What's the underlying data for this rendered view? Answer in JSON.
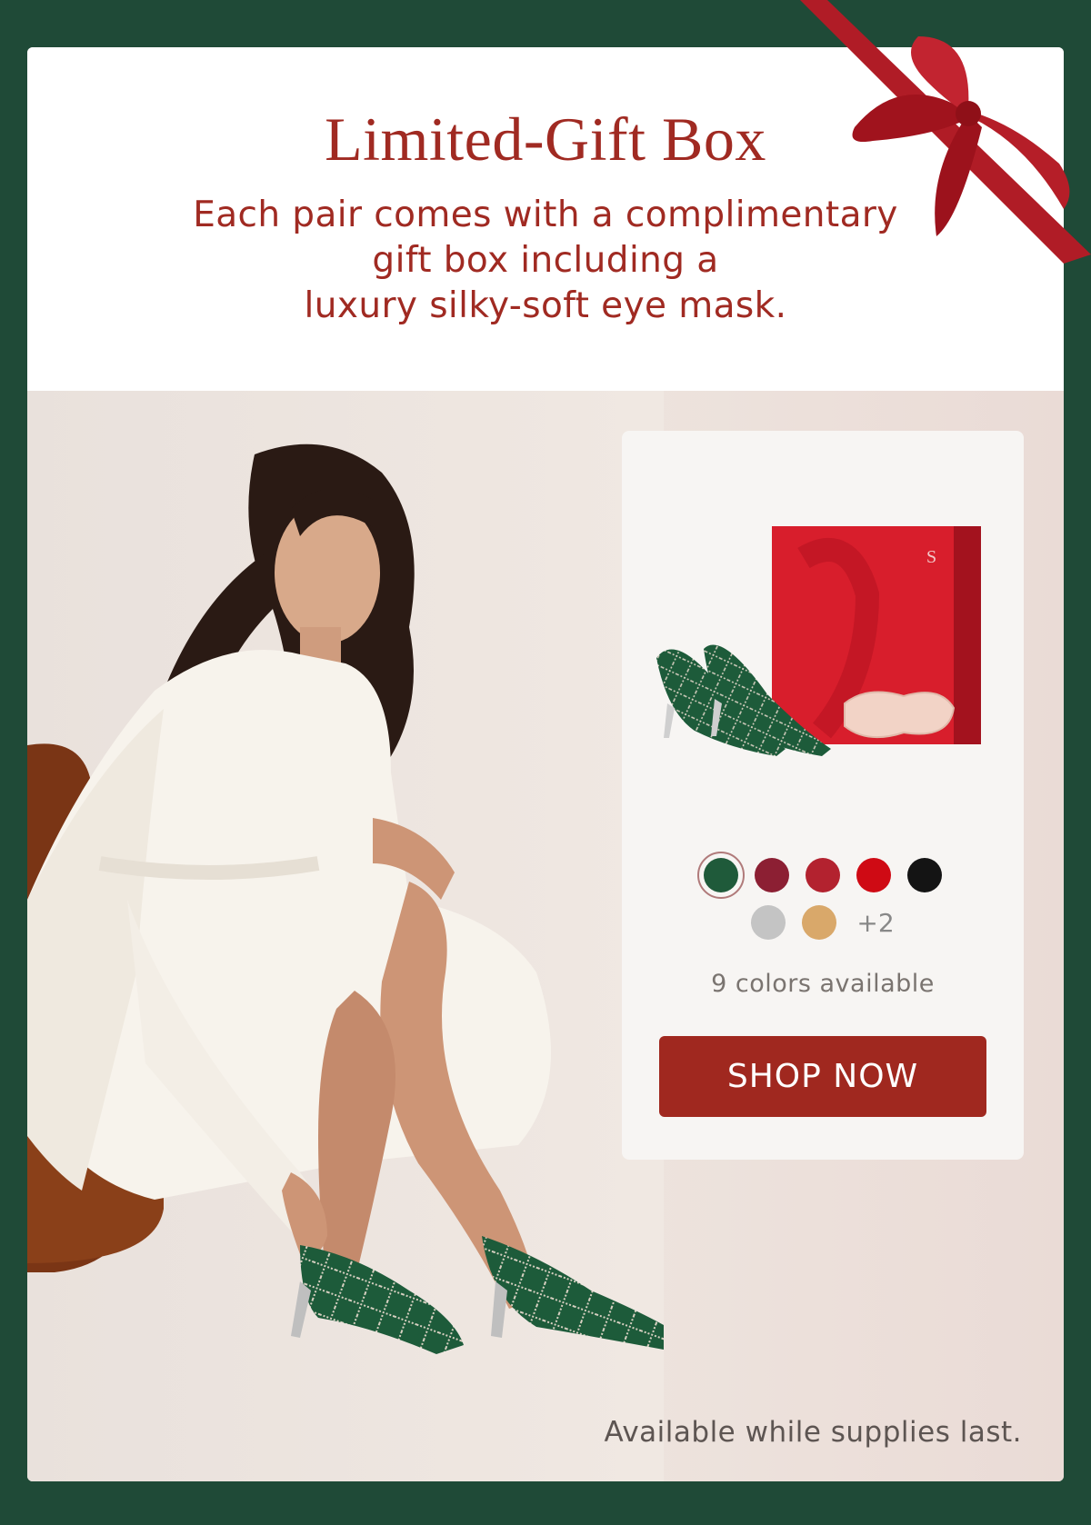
{
  "header": {
    "title": "Limited-Gift Box",
    "subtitle_lines": [
      "Each pair comes with a complimentary",
      "gift box including a",
      "luxury silky-soft eye mask."
    ]
  },
  "colors": {
    "background": "#1f4a37",
    "accent": "#a02a22",
    "button": "#a0281f"
  },
  "swatches": {
    "row1": [
      {
        "name": "green-plaid",
        "color": "#1f5a3a",
        "selected": true
      },
      {
        "name": "burgundy-plaid",
        "color": "#8c1f33",
        "selected": false
      },
      {
        "name": "red-glitter",
        "color": "#b3222f",
        "selected": false
      },
      {
        "name": "red",
        "color": "#cf0a14",
        "selected": false
      },
      {
        "name": "black",
        "color": "#141414",
        "selected": false
      }
    ],
    "row2": [
      {
        "name": "silver",
        "color": "#c4c4c4",
        "selected": false
      },
      {
        "name": "gold",
        "color": "#d9a86a",
        "selected": false
      }
    ],
    "more_label": "+2",
    "note": "9 colors available"
  },
  "cta": {
    "label": "SHOP NOW"
  },
  "footer": {
    "note": "Available while supplies last."
  }
}
